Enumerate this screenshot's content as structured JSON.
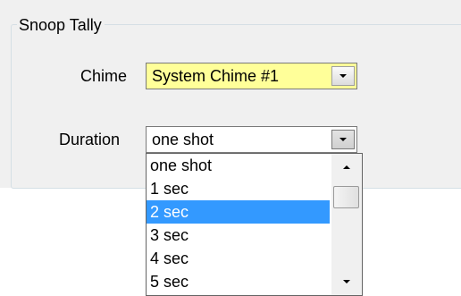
{
  "group": {
    "title": "Snoop Tally"
  },
  "chime": {
    "label": "Chime",
    "value": "System Chime #1",
    "highlight_color": "#ffff99"
  },
  "duration": {
    "label": "Duration",
    "value": "one shot",
    "options": [
      "one shot",
      "1 sec",
      "2 sec",
      "3 sec",
      "4 sec",
      "5 sec"
    ],
    "highlighted_option": "2 sec"
  },
  "icons": {
    "chime_dropdown": "chevron-down-icon",
    "duration_dropdown": "chevron-down-icon",
    "scroll_up": "arrow-up-icon",
    "scroll_down": "arrow-down-icon"
  },
  "colors": {
    "selection": "#3399ff",
    "dialog_background": "#f0f0f0"
  }
}
